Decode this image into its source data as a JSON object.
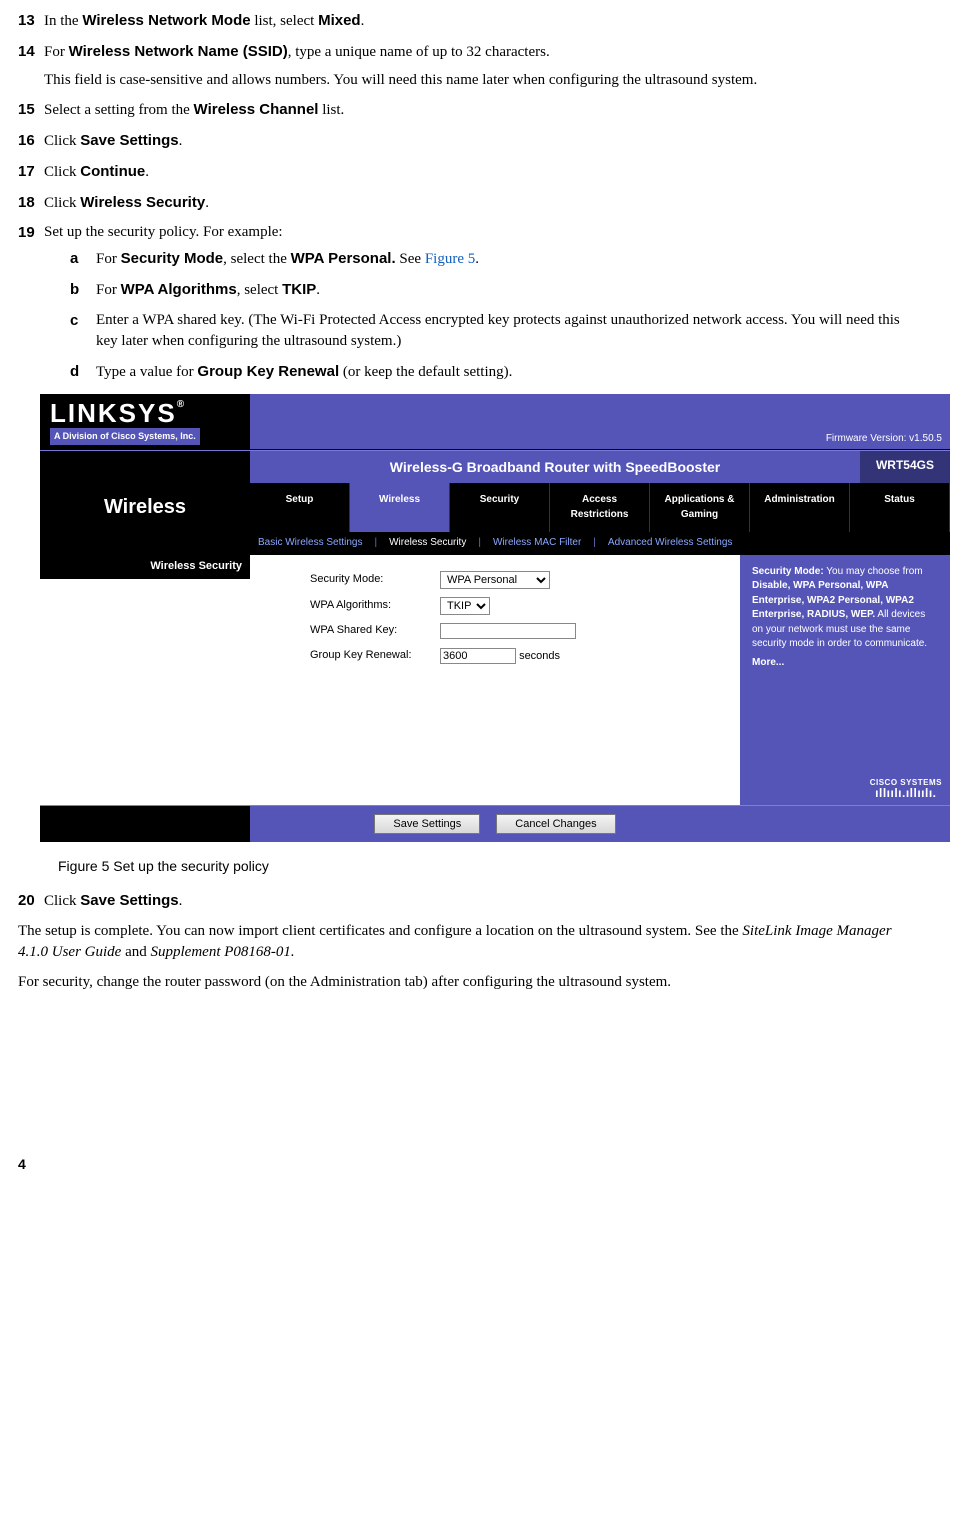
{
  "steps": {
    "s13": {
      "num": "13",
      "t1": "In the ",
      "b1": "Wireless Network Mode",
      "t2": " list, select ",
      "b2": "Mixed",
      "t3": "."
    },
    "s14": {
      "num": "14",
      "t1": "For ",
      "b1": "Wireless Network Name (SSID)",
      "t2": ", type a unique name of up to 32 characters.",
      "p": "This field is case-sensitive and allows numbers. You will need this name later when configuring the ultrasound system."
    },
    "s15": {
      "num": "15",
      "t1": "Select a setting from the ",
      "b1": "Wireless Channel",
      "t2": " list."
    },
    "s16": {
      "num": "16",
      "t1": "Click ",
      "b1": "Save Settings",
      "t2": "."
    },
    "s17": {
      "num": "17",
      "t1": "Click ",
      "b1": "Continue",
      "t2": "."
    },
    "s18": {
      "num": "18",
      "t1": "Click ",
      "b1": "Wireless Security",
      "t2": "."
    },
    "s19": {
      "num": "19",
      "t1": "Set up the security policy. For example:"
    },
    "s20": {
      "num": "20",
      "t1": "Click ",
      "b1": "Save Settings",
      "t2": "."
    }
  },
  "sub": {
    "a": {
      "k": "a",
      "t1": "For ",
      "b1": "Security Mode",
      "t2": ", select the ",
      "b2": "WPA Personal.",
      "t3": " See ",
      "link": "Figure 5",
      "t4": "."
    },
    "b": {
      "k": "b",
      "t1": "For ",
      "b1": "WPA Algorithms",
      "t2": ", select ",
      "b2": "TKIP",
      "t3": "."
    },
    "c": {
      "k": "c",
      "t1": "Enter a WPA shared key. (The Wi-Fi Protected Access encrypted key protects against unauthorized network access. You will need this key later when configuring the ultrasound system.)"
    },
    "d": {
      "k": "d",
      "t1": "Type a value for ",
      "b1": "Group Key Renewal",
      "t2": " (or keep the default setting)."
    }
  },
  "router": {
    "brand": "LINKSYS",
    "reg": "®",
    "division": "A Division of Cisco Systems, Inc.",
    "firmware": "Firmware Version: v1.50.5",
    "product": "Wireless-G Broadband Router with SpeedBooster",
    "model": "WRT54GS",
    "side_title": "Wireless",
    "tabs": [
      "Setup",
      "Wireless",
      "Security",
      "Access Restrictions",
      "Applications & Gaming",
      "Administration",
      "Status"
    ],
    "subtabs": [
      "Basic Wireless Settings",
      "Wireless Security",
      "Wireless MAC Filter",
      "Advanced Wireless Settings"
    ],
    "section": "Wireless Security",
    "labels": {
      "mode": "Security Mode:",
      "algo": "WPA Algorithms:",
      "key": "WPA Shared  Key:",
      "renew": "Group Key  Renewal:"
    },
    "vals": {
      "mode": "WPA Personal",
      "algo": "TKIP",
      "key": "",
      "renew": "3600",
      "renew_unit": "seconds"
    },
    "help": {
      "l1": "Security Mode:",
      "t1": " You may choose from ",
      "b1": "Disable, WPA Personal, WPA Enterprise, WPA2 Personal, WPA2 Enterprise, RADIUS, WEP.",
      "t2": " All devices on your network must use the same security mode in order to communicate.",
      "more": "More..."
    },
    "cisco": "CISCO SYSTEMS",
    "btn_save": "Save Settings",
    "btn_cancel": "Cancel Changes"
  },
  "caption": "Figure 5  Set up the security policy",
  "closing": {
    "p1a": "The setup is complete. You can now import client certificates and configure a location on the ultrasound system. See the ",
    "p1i1": "SiteLink Image Manager 4.1.0 User Guide",
    "p1b": " and ",
    "p1i2": "Supplement P08168-01.",
    "p2": "For security, change the router password (on the Administration tab) after configuring the ultrasound system."
  },
  "pagenum": "4"
}
